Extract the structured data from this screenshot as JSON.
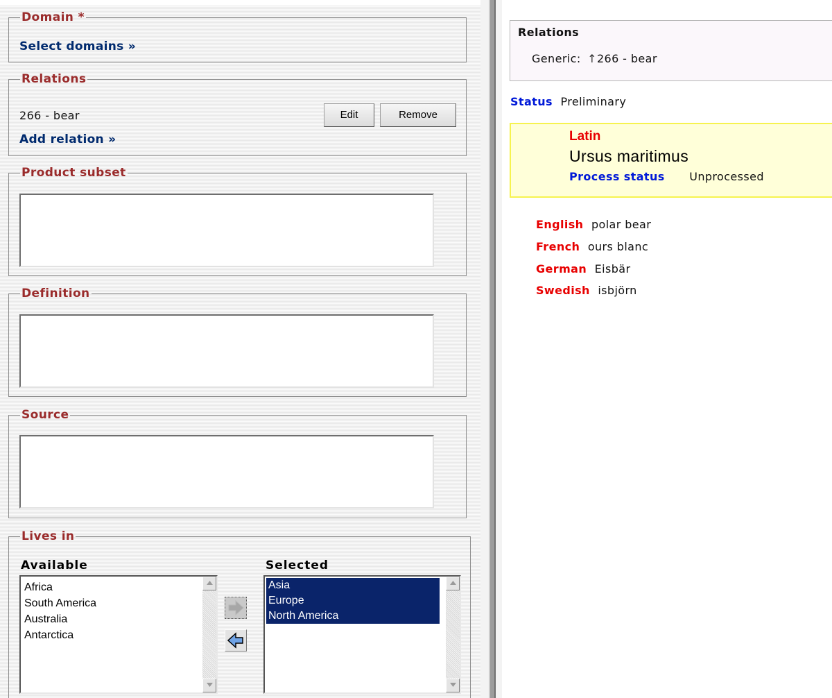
{
  "left": {
    "domain": {
      "legend": "Domain *",
      "link": "Select domains »"
    },
    "relations": {
      "legend": "Relations",
      "item": "266 - bear",
      "edit": "Edit",
      "remove": "Remove",
      "add": "Add relation »"
    },
    "product_subset": {
      "legend": "Product subset"
    },
    "definition": {
      "legend": "Definition"
    },
    "source": {
      "legend": "Source"
    },
    "lives_in": {
      "legend": "Lives in",
      "available_label": "Available",
      "selected_label": "Selected",
      "available": [
        "Africa",
        "South America",
        "Australia",
        "Antarctica"
      ],
      "selected": [
        "Asia",
        "Europe",
        "North America"
      ]
    }
  },
  "right": {
    "relations": {
      "title": "Relations",
      "generic_label": "Generic:",
      "arrow": "↑",
      "generic_value": "266 - bear"
    },
    "status": {
      "label": "Status",
      "value": "Preliminary"
    },
    "latin": {
      "language": "Latin",
      "term": "Ursus maritimus",
      "process_label": "Process status",
      "process_value": "Unprocessed"
    },
    "translations": [
      {
        "language": "English",
        "term": "polar bear"
      },
      {
        "language": "French",
        "term": "ours blanc"
      },
      {
        "language": "German",
        "term": "Eisbär"
      },
      {
        "language": "Swedish",
        "term": "isbjörn"
      }
    ]
  },
  "colors": {
    "legend": "#9a2b2b",
    "link": "#002a6e",
    "label_blue": "#0019d8",
    "label_red": "#e80000",
    "selection": "#0a246a",
    "latin_box": "#ffffd9"
  }
}
